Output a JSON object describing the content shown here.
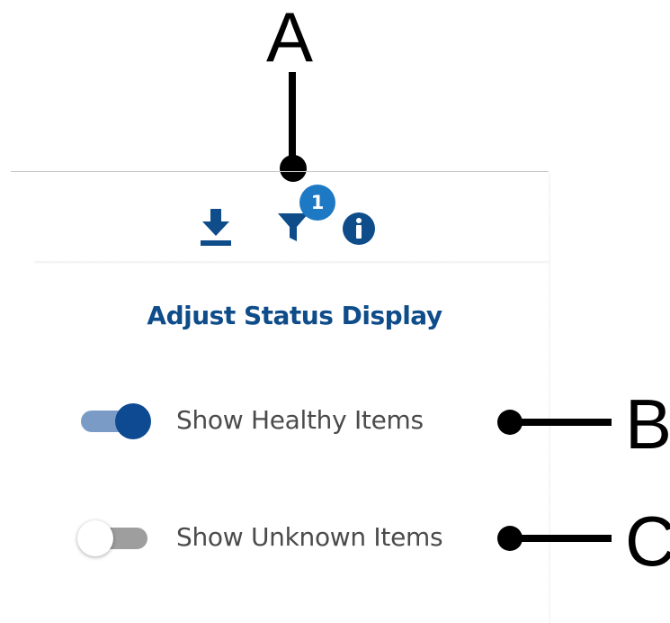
{
  "callouts": {
    "a": "A",
    "b": "B",
    "c": "C"
  },
  "toolbar": {
    "download_icon": "download-icon",
    "filter_icon": "filter-icon",
    "info_icon": "info-icon",
    "filter_badge_count": "1"
  },
  "panel": {
    "title": "Adjust Status Display",
    "toggles": [
      {
        "label": "Show Healthy Items",
        "on": true
      },
      {
        "label": "Show Unknown Items",
        "on": false
      }
    ]
  },
  "colors": {
    "brand_dark": "#0e4c8a",
    "badge": "#1e79c4",
    "toggle_on_knob": "#0d4a92",
    "toggle_on_track": "#7a9bc6",
    "toggle_off_track": "#9e9e9e",
    "toggle_off_knob": "#ffffff",
    "label_text": "#4b4b4b"
  }
}
